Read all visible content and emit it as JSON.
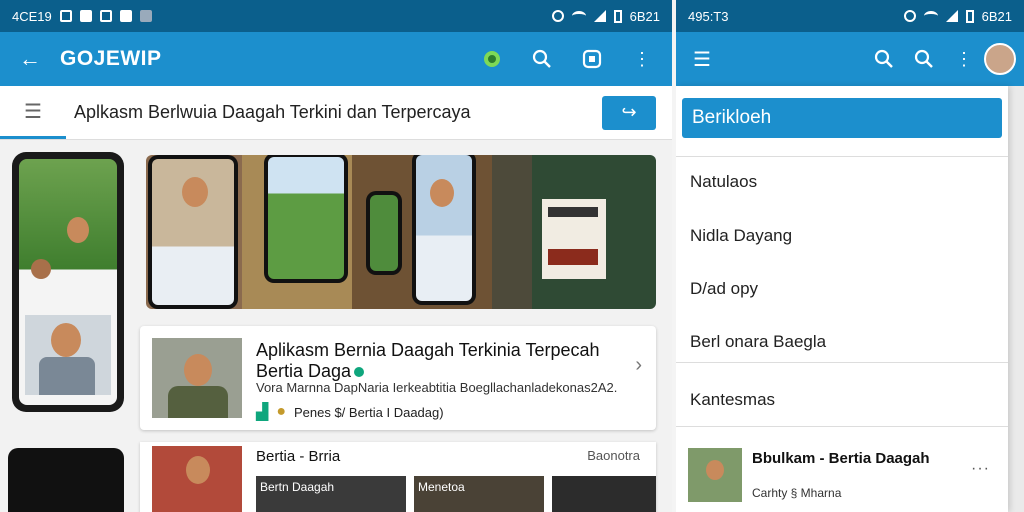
{
  "left": {
    "statusbar": {
      "time": "4CE19",
      "right_time": "6B21"
    },
    "appbar": {
      "back_icon": "arrow-left-icon",
      "title": "GOJEWIP"
    },
    "search": {
      "text": "Aplkasm Berlwuia Daagah Terkini dan Terpercaya",
      "go_icon": "share-arrow-icon"
    },
    "card": {
      "title": "Aplikasm Bernia Daagah Terkinia Terpecah Bertia Daga",
      "sub": "Vora Marnna DapNaria Ierkeabtitia Boegllachanladekonas2A2.",
      "meta": "Penes $/ Bertia I Daadag)"
    },
    "card2": {
      "title": "Bertia - Brria",
      "right": "Baonotra",
      "tiles": [
        "Bertn Daagah",
        "Menetoa"
      ]
    }
  },
  "right": {
    "statusbar": {
      "time": "495:T3",
      "right_time": "6B21"
    },
    "drawer": {
      "header": "Berikloeh",
      "items": [
        "Natulaos",
        "Nidla Dayang",
        "D/ad opy",
        "Berl onara Baegla",
        "Kantesmas"
      ],
      "featured": {
        "title": "Bbulkam - Bertia Daagah",
        "sub": "Carhty § Mharna"
      }
    }
  },
  "colors": {
    "primary": "#1c8fcd",
    "statusbar": "#0b5f8c",
    "verified": "#0fa67d"
  }
}
